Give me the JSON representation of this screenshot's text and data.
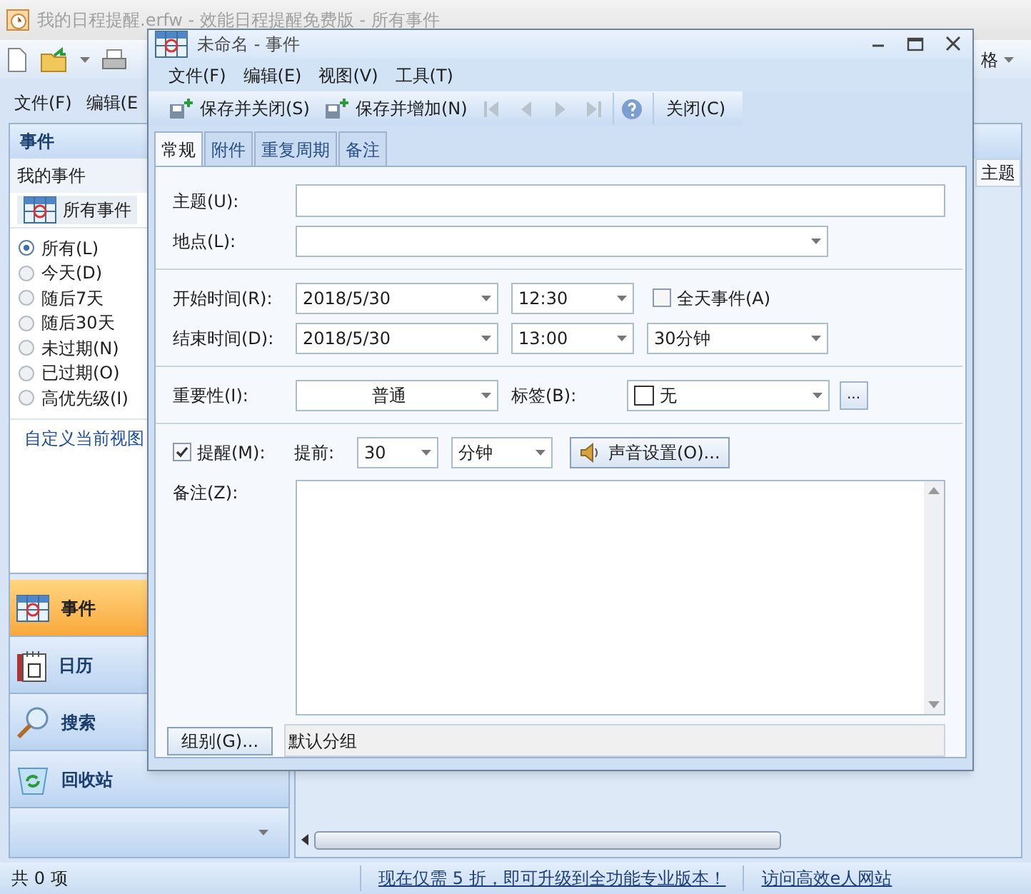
{
  "main_window": {
    "title": "我的日程提醒.erfw - 效能日程提醒免费版 - 所有事件",
    "toolbar_partial_button": "格",
    "menu": [
      "文件(F)",
      "编辑(E"
    ]
  },
  "left_panel": {
    "header": "事件",
    "section": "我的事件",
    "view_button": "所有事件",
    "filters": [
      {
        "label": "所有(L)",
        "selected": true
      },
      {
        "label": "今天(D)",
        "selected": false
      },
      {
        "label": "随后7天",
        "selected": false
      },
      {
        "label": "随后30天",
        "selected": false
      },
      {
        "label": "未过期(N)",
        "selected": false
      },
      {
        "label": "已过期(O)",
        "selected": false
      },
      {
        "label": "高优先级(I)",
        "selected": false
      }
    ],
    "custom_view_link": "自定义当前视图",
    "nav": [
      {
        "label": "事件",
        "kind": "events",
        "selected": true
      },
      {
        "label": "日历",
        "kind": "calendar",
        "selected": false
      },
      {
        "label": "搜索",
        "kind": "search",
        "selected": false
      },
      {
        "label": "回收站",
        "kind": "recycle",
        "selected": false
      }
    ]
  },
  "list": {
    "columns": [
      "主题"
    ]
  },
  "status_bar": {
    "count": "共 0 项",
    "upgrade_link": "现在仅需 5 折，即可升级到全功能专业版本！",
    "website_link": "访问高效e人网站"
  },
  "dialog": {
    "title": "未命名 - 事件",
    "menu": [
      "文件(F)",
      "编辑(E)",
      "视图(V)",
      "工具(T)"
    ],
    "toolbar": [
      {
        "kind": "save",
        "label": "保存并关闭(S)"
      },
      {
        "kind": "save_new",
        "label": "保存并增加(N)"
      },
      {
        "kind": "first"
      },
      {
        "kind": "prev"
      },
      {
        "kind": "next"
      },
      {
        "kind": "last"
      },
      {
        "kind": "help"
      },
      {
        "kind": "text",
        "label": "关闭(C)"
      }
    ],
    "tabs": [
      {
        "label": "常规",
        "selected": true
      },
      {
        "label": "附件",
        "selected": false
      },
      {
        "label": "重复周期",
        "selected": false
      },
      {
        "label": "备注",
        "selected": false
      }
    ],
    "subject_label": "主题(U):",
    "location_label": "地点(L):",
    "start_label": "开始时间(R):",
    "start_date": "2018/5/30",
    "start_time": "12:30",
    "all_day": {
      "label": "全天事件(A)",
      "checked": false
    },
    "end_label": "结束时间(D):",
    "end_date": "2018/5/30",
    "end_time": "13:00",
    "duration": "30分钟",
    "importance_label": "重要性(I):",
    "importance": "普通",
    "tag_label": "标签(B):",
    "tag": "无",
    "more_button": "...",
    "reminder": {
      "label": "提醒(M):",
      "checked": true
    },
    "advance_label": "提前:",
    "advance_value": "30",
    "advance_unit": "分钟",
    "sound_button": "声音设置(O)...",
    "notes_label": "备注(Z):",
    "group_button": "组别(G)...",
    "group_value": "默认分组"
  }
}
